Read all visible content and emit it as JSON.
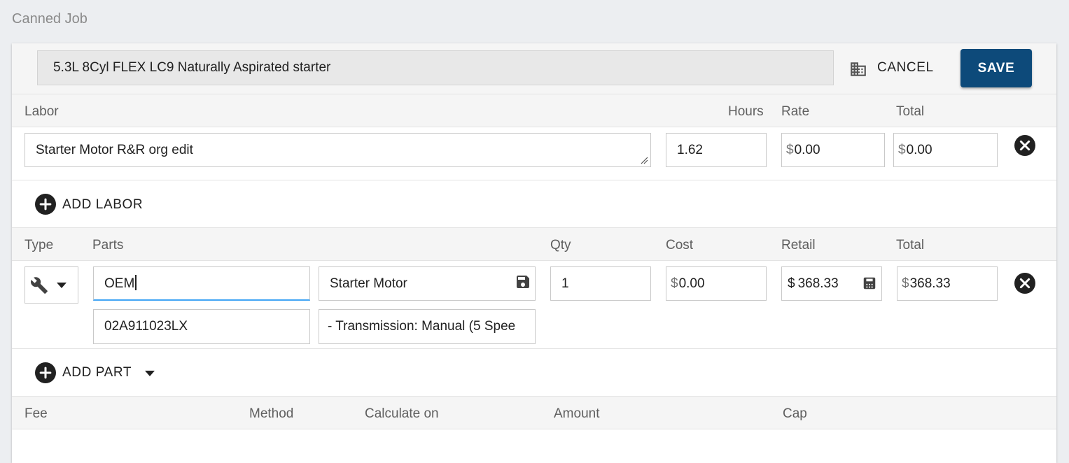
{
  "page": {
    "title": "Canned Job"
  },
  "header": {
    "job_name": "5.3L 8Cyl FLEX LC9 Naturally Aspirated starter",
    "cancel_label": "CANCEL",
    "save_label": "SAVE"
  },
  "labor": {
    "columns": {
      "labor": "Labor",
      "hours": "Hours",
      "rate": "Rate",
      "total": "Total"
    },
    "rows": [
      {
        "description": "Starter Motor R&R org edit",
        "hours": "1.62",
        "rate": "0.00",
        "total": "0.00",
        "currency": "$"
      }
    ],
    "add_label": "ADD LABOR"
  },
  "parts": {
    "columns": {
      "type": "Type",
      "parts": "Parts",
      "qty": "Qty",
      "cost": "Cost",
      "retail": "Retail",
      "total": "Total"
    },
    "rows": [
      {
        "type_icon": "wrench-icon",
        "brand": "OEM",
        "name": "Starter Motor",
        "part_number": "02A911023LX",
        "note": " - Transmission: Manual (5 Spee",
        "qty": "1",
        "cost": "0.00",
        "retail": "368.33",
        "total": "368.33",
        "currency": "$"
      }
    ],
    "add_label": "ADD PART"
  },
  "fees": {
    "columns": {
      "fee": "Fee",
      "method": "Method",
      "calculate_on": "Calculate on",
      "amount": "Amount",
      "cap": "Cap"
    }
  },
  "colors": {
    "accent": "#0d4a7a",
    "focus": "#42a5f5",
    "icon": "#212121"
  }
}
